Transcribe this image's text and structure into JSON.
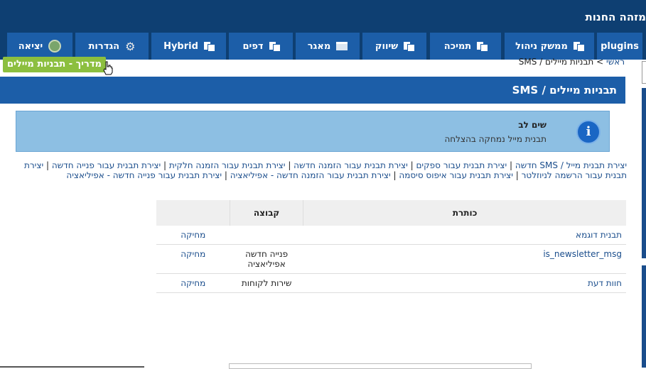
{
  "store_title": "מזהה החנות",
  "nav": {
    "tabs": [
      {
        "label": "plugins"
      },
      {
        "label": "ממשק ניהול"
      },
      {
        "label": "תמיכה"
      },
      {
        "label": "שיווק"
      },
      {
        "label": "מאגר"
      },
      {
        "label": "דפים"
      },
      {
        "label": "Hybrid"
      },
      {
        "label": "הגדרות"
      },
      {
        "label": "יציאה"
      }
    ]
  },
  "tooltip": "מדריך - תבניות מיילים",
  "breadcrumb": {
    "home": "ראשי",
    "sep": " > ",
    "current": "תבניות מיילים / SMS"
  },
  "page_title": "תבניות מיילים / SMS",
  "notice": {
    "title": "שים לב",
    "message": "תבנית מייל נמחקה בהצלחה",
    "icon": "info-icon"
  },
  "links": [
    "יצירת תבנית מייל / SMS חדשה",
    "יצירת תבנית עבור ספקים",
    "יצירת תבנית עבור הזמנה חדשה",
    "יצירת תבנית עבור הזמנה חלקית",
    "יצירת תבנית עבור פנייה חדשה",
    "יצירת תבנית עבור הרשמה לניוזלטר",
    "יצירת תבנית עבור איפוס סיסמה",
    "יצירת תבנית עבור הזמנה חדשה - אפיליאציה",
    "יצירת תבנית עבור פנייה חדשה - אפיליאציה"
  ],
  "table": {
    "headers": {
      "title": "כותרת",
      "group": "קבוצה"
    },
    "rows": [
      {
        "title": "תבנית דוגמא",
        "group": "",
        "action": "מחיקה"
      },
      {
        "title": "is_newsletter_msg",
        "group": "פנייה חדשה אפיליאציה",
        "action": "מחיקה"
      },
      {
        "title": "חוות דעת",
        "group": "שירות לקוחות",
        "action": "מחיקה"
      }
    ]
  },
  "colors": {
    "navy": "#0e3f72",
    "tab_blue": "#1c5ea8",
    "notice_bg": "#8dbfe3",
    "tooltip_green": "#8cbf3f",
    "link": "#1a4d8c"
  }
}
